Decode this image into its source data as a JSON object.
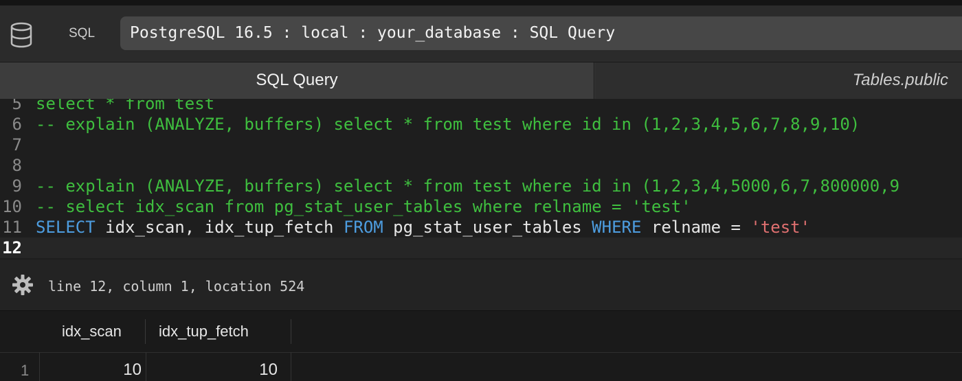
{
  "toolbar": {
    "mode_label": "SQL",
    "address": "PostgreSQL 16.5 : local : your_database : SQL Query"
  },
  "tabs": [
    {
      "label": "SQL Query",
      "active": true
    },
    {
      "label": "Tables.public",
      "active": false
    }
  ],
  "editor": {
    "lines": [
      {
        "num": "5",
        "text": "   select * from test"
      },
      {
        "num": "6",
        "text": "-- explain (ANALYZE, buffers) select * from test where id in (1,2,3,4,5,6,7,8,9,10)"
      },
      {
        "num": "7",
        "text": ""
      },
      {
        "num": "8",
        "text": ""
      },
      {
        "num": "9",
        "text": "-- explain (ANALYZE, buffers) select * from test where id in (1,2,3,4,5000,6,7,800000,9"
      },
      {
        "num": "10",
        "text": "-- select idx_scan from pg_stat_user_tables where relname = 'test'"
      },
      {
        "num": "11",
        "kw1": "SELECT",
        "t1": " idx_scan, idx_tup_fetch ",
        "kw2": "FROM",
        "t2": " pg_stat_user_tables ",
        "kw3": "WHERE",
        "t3": " relname = ",
        "str": "'test'"
      },
      {
        "num": "12",
        "text": ""
      }
    ]
  },
  "status": {
    "text": "line 12, column 1, location 524"
  },
  "results": {
    "columns": [
      "idx_scan",
      "idx_tup_fetch"
    ],
    "rows": [
      {
        "num": "1",
        "cells": [
          "10",
          "10"
        ]
      }
    ]
  },
  "icons": {
    "database": "database-icon",
    "settings": "gear-icon"
  }
}
